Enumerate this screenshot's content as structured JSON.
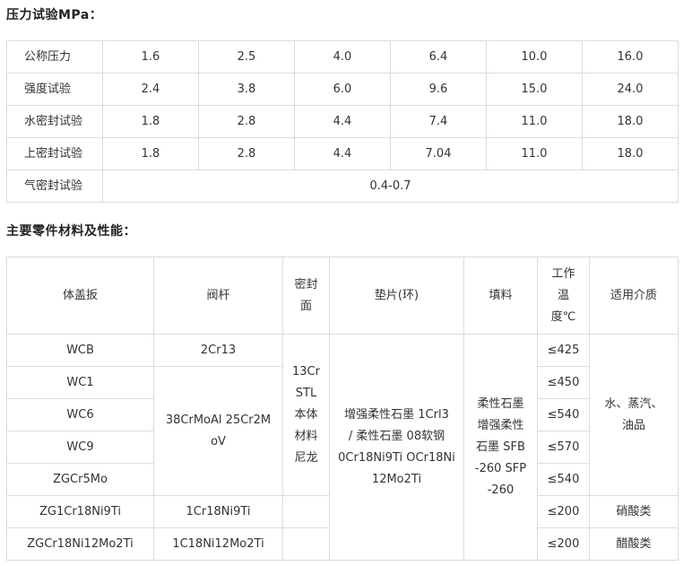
{
  "pressure_heading": "压力试验MPa：",
  "pressure_rows": [
    {
      "label": "公称压力",
      "values": [
        "1.6",
        "2.5",
        "4.0",
        "6.4",
        "10.0",
        "16.0"
      ]
    },
    {
      "label": "强度试验",
      "values": [
        "2.4",
        "3.8",
        "6.0",
        "9.6",
        "15.0",
        "24.0"
      ]
    },
    {
      "label": "水密封试验",
      "values": [
        "1.8",
        "2.8",
        "4.4",
        "7.4",
        "11.0",
        "18.0"
      ]
    },
    {
      "label": "上密封试验",
      "values": [
        "1.8",
        "2.8",
        "4.4",
        "7.04",
        "11.0",
        "18.0"
      ]
    }
  ],
  "gas_row": {
    "label": "气密封试验",
    "value": "0.4-0.7"
  },
  "materials_heading": "主要零件材料及性能：",
  "materials_headers": {
    "body": "体盖扳",
    "stem": "阀杆",
    "seal_lines": [
      "密封",
      "面"
    ],
    "gasket": "垫片(环)",
    "packing": "填料",
    "temp_lines": [
      "工作",
      "温",
      "度℃"
    ],
    "medium": "适用介质"
  },
  "materials_rows": [
    {
      "body": "WCB",
      "temp": "≤425"
    },
    {
      "body": "WC1",
      "temp": "≤450"
    },
    {
      "body": "WC6",
      "temp": "≤540"
    },
    {
      "body": "WC9",
      "temp": "≤570"
    },
    {
      "body": "ZGCr5Mo",
      "temp": "≤540"
    },
    {
      "body": "ZG1Cr18Ni9Ti",
      "temp": "≤200"
    },
    {
      "body": "ZGCr18Ni12Mo2Ti",
      "temp": "≤200"
    }
  ],
  "materials_merged": {
    "stem_wcb": "2Cr13",
    "stem_group_lines": [
      "38CrMoAl 25Cr2M",
      "oV"
    ],
    "stem_304": "1Cr18Ni9Ti",
    "stem_316": "1C18Ni12Mo2Ti",
    "seal_lines": [
      "13Cr",
      "STL",
      "本体",
      "材料",
      "尼龙"
    ],
    "gasket_lines": [
      "增强柔性石墨 1Crl3",
      "/ 柔性石墨 08软钢",
      "0Cr18Ni9Ti OCr18Ni",
      "12Mo2Ti"
    ],
    "packing_lines": [
      "柔性石墨",
      "增强柔性",
      "石墨 SFB",
      "-260 SFP",
      "-260"
    ],
    "medium_group_lines": [
      "水、蒸汽、",
      "油品"
    ],
    "medium_304": "硝酸类",
    "medium_316": "醋酸类"
  }
}
